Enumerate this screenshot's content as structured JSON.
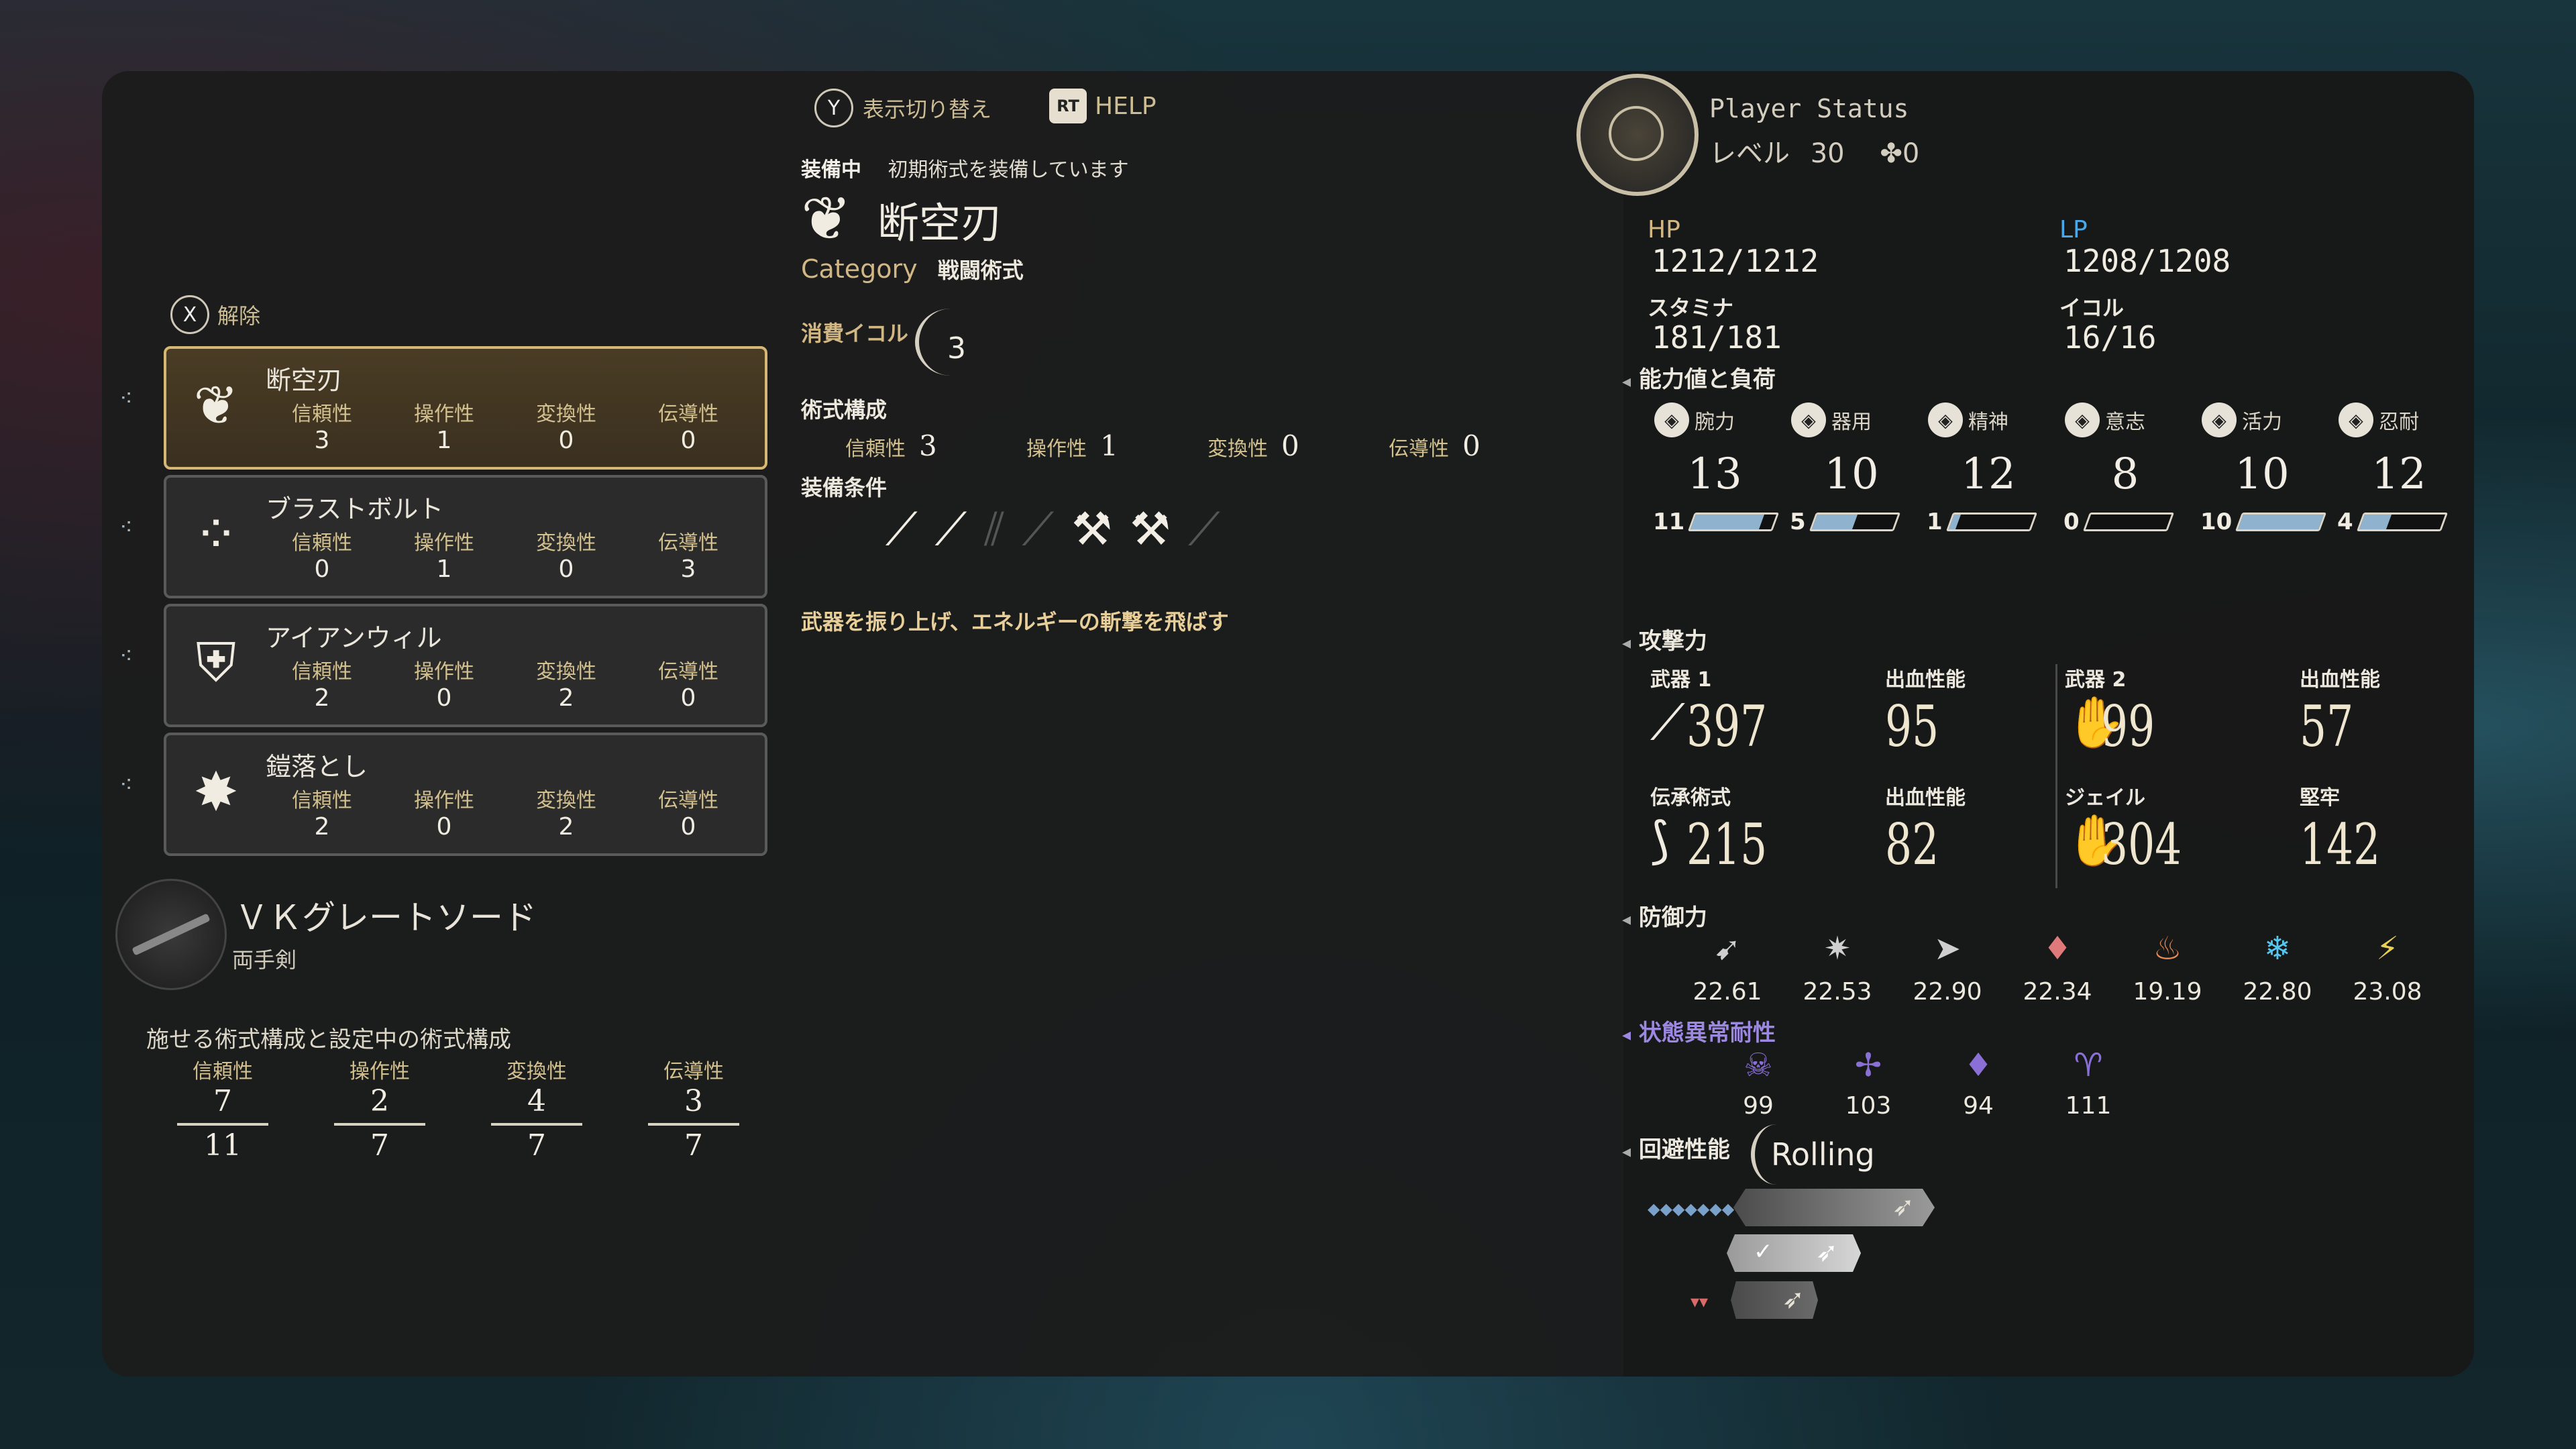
{
  "header": {
    "y_button": "Y",
    "toggle_label": "表示切り替え",
    "rt_button": "RT",
    "help_label": "HELP",
    "x_button": "X",
    "release_label": "解除"
  },
  "arts": [
    {
      "name": "断空刃",
      "stats": [
        {
          "label": "信頼性",
          "value": "3"
        },
        {
          "label": "操作性",
          "value": "1"
        },
        {
          "label": "変換性",
          "value": "0"
        },
        {
          "label": "伝導性",
          "value": "0"
        }
      ],
      "icon": "wing-slash-icon",
      "selected": true
    },
    {
      "name": "ブラストボルト",
      "stats": [
        {
          "label": "信頼性",
          "value": "0"
        },
        {
          "label": "操作性",
          "value": "1"
        },
        {
          "label": "変換性",
          "value": "0"
        },
        {
          "label": "伝導性",
          "value": "3"
        }
      ],
      "icon": "orbs-icon",
      "selected": false
    },
    {
      "name": "アイアンウィル",
      "stats": [
        {
          "label": "信頼性",
          "value": "2"
        },
        {
          "label": "操作性",
          "value": "0"
        },
        {
          "label": "変換性",
          "value": "2"
        },
        {
          "label": "伝導性",
          "value": "0"
        }
      ],
      "icon": "shield-arrow-icon",
      "selected": false
    },
    {
      "name": "鎧落とし",
      "stats": [
        {
          "label": "信頼性",
          "value": "2"
        },
        {
          "label": "操作性",
          "value": "0"
        },
        {
          "label": "変換性",
          "value": "2"
        },
        {
          "label": "伝導性",
          "value": "0"
        }
      ],
      "icon": "shatter-icon",
      "selected": false
    }
  ],
  "weapon": {
    "name": "ＶＫグレートソード",
    "type": "両手剣"
  },
  "capacity": {
    "title": "施せる術式構成と設定中の術式構成",
    "cols": [
      {
        "label": "信頼性",
        "current": "7",
        "max": "11"
      },
      {
        "label": "操作性",
        "current": "2",
        "max": "7"
      },
      {
        "label": "変換性",
        "current": "4",
        "max": "7"
      },
      {
        "label": "伝導性",
        "current": "3",
        "max": "7"
      }
    ]
  },
  "detail": {
    "equipped_tag": "装備中",
    "equipped_note": "初期術式を装備しています",
    "name": "断空刃",
    "category_label": "Category",
    "category_value": "戦闘術式",
    "ichor_label": "消費イコル",
    "ichor_value": "3",
    "composition_label": "術式構成",
    "composition": [
      {
        "label": "信頼性",
        "value": "3"
      },
      {
        "label": "操作性",
        "value": "1"
      },
      {
        "label": "変換性",
        "value": "0"
      },
      {
        "label": "伝導性",
        "value": "0"
      }
    ],
    "requirement_label": "装備条件",
    "description": "武器を振り上げ、エネルギーの斬撃を飛ばす"
  },
  "status": {
    "title": "Player Status",
    "level_label": "レベル",
    "level": "30",
    "points": "0",
    "hp_label": "HP",
    "hp": "1212/1212",
    "lp_label": "LP",
    "lp": "1208/1208",
    "stamina_label": "スタミナ",
    "stamina": "181/181",
    "ichor_label": "イコル",
    "ichor": "16/16",
    "abilities_title": "能力値と負荷",
    "abilities": [
      {
        "name": "腕力",
        "value": "13",
        "load": "11",
        "fill": 0.85
      },
      {
        "name": "器用",
        "value": "10",
        "load": "5",
        "fill": 0.5
      },
      {
        "name": "精神",
        "value": "12",
        "load": "1",
        "fill": 0.08
      },
      {
        "name": "意志",
        "value": "8",
        "load": "0",
        "fill": 0.0
      },
      {
        "name": "活力",
        "value": "10",
        "load": "10",
        "fill": 1.0
      },
      {
        "name": "忍耐",
        "value": "12",
        "load": "4",
        "fill": 0.33
      }
    ],
    "attack_title": "攻撃力",
    "attack": [
      {
        "label": "武器 1",
        "value": "397",
        "icon": "greatsword-icon"
      },
      {
        "label": "出血性能",
        "value": "95",
        "icon": ""
      },
      {
        "label": "武器 2",
        "value": "99",
        "icon": "gauntlet-icon"
      },
      {
        "label": "出血性能",
        "value": "57",
        "icon": ""
      },
      {
        "label": "伝承術式",
        "value": "215",
        "icon": "bow-icon"
      },
      {
        "label": "出血性能",
        "value": "82",
        "icon": ""
      },
      {
        "label": "ジェイル",
        "value": "304",
        "icon": "claw-icon"
      },
      {
        "label": "堅牢",
        "value": "142",
        "icon": ""
      }
    ],
    "defense_title": "防御力",
    "defense": [
      {
        "value": "22.61",
        "icon": "slash-icon",
        "color": "#cfcfcf"
      },
      {
        "value": "22.53",
        "icon": "blunt-icon",
        "color": "#cfcfcf"
      },
      {
        "value": "22.90",
        "icon": "pierce-icon",
        "color": "#cfcfcf"
      },
      {
        "value": "22.34",
        "icon": "blood-icon",
        "color": "#e07a7a"
      },
      {
        "value": "19.19",
        "icon": "fire-icon",
        "color": "#e88a55"
      },
      {
        "value": "22.80",
        "icon": "ice-icon",
        "color": "#56c6f0"
      },
      {
        "value": "23.08",
        "icon": "lightning-icon",
        "color": "#e8cf55"
      }
    ],
    "resist_title": "状態異常耐性",
    "resist": [
      {
        "value": "99",
        "icon": "poison-icon"
      },
      {
        "value": "103",
        "icon": "bleed-icon"
      },
      {
        "value": "94",
        "icon": "curse-icon"
      },
      {
        "value": "111",
        "icon": "frenzy-icon"
      }
    ],
    "evasion_title": "回避性能",
    "evasion_value": "Rolling",
    "check_mark": "✓"
  },
  "colors": {
    "accent_gold": "#d7b774",
    "lp_blue": "#4aa8e8",
    "resist_purple": "#8a70d6"
  }
}
